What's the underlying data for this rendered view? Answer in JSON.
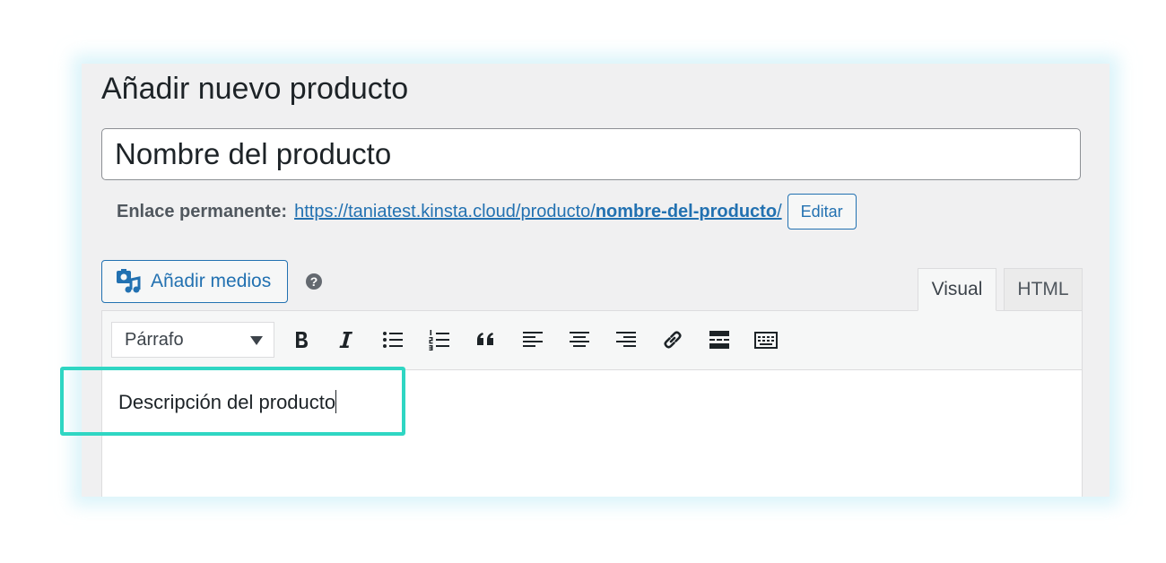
{
  "page": {
    "title": "Añadir nuevo producto"
  },
  "product_title": {
    "value": "Nombre del producto"
  },
  "permalink": {
    "label": "Enlace permanente:",
    "url_base": "https://taniatest.kinsta.cloud/producto/",
    "url_slug": "nombre-del-producto",
    "url_trail": "/",
    "edit_label": "Editar"
  },
  "media": {
    "add_label": "Añadir medios",
    "help_glyph": "?"
  },
  "tabs": [
    {
      "label": "Visual",
      "active": true
    },
    {
      "label": "HTML",
      "active": false
    }
  ],
  "toolbar": {
    "format_value": "Párrafo",
    "buttons": [
      "bold-icon",
      "italic-icon",
      "bulleted-list-icon",
      "numbered-list-icon",
      "blockquote-icon",
      "align-left-icon",
      "align-center-icon",
      "align-right-icon",
      "link-icon",
      "read-more-icon",
      "toolbar-toggle-icon"
    ]
  },
  "editor": {
    "content": "Descripción del producto"
  },
  "colors": {
    "accent": "#2271b1",
    "highlight": "#2fd6c3"
  }
}
